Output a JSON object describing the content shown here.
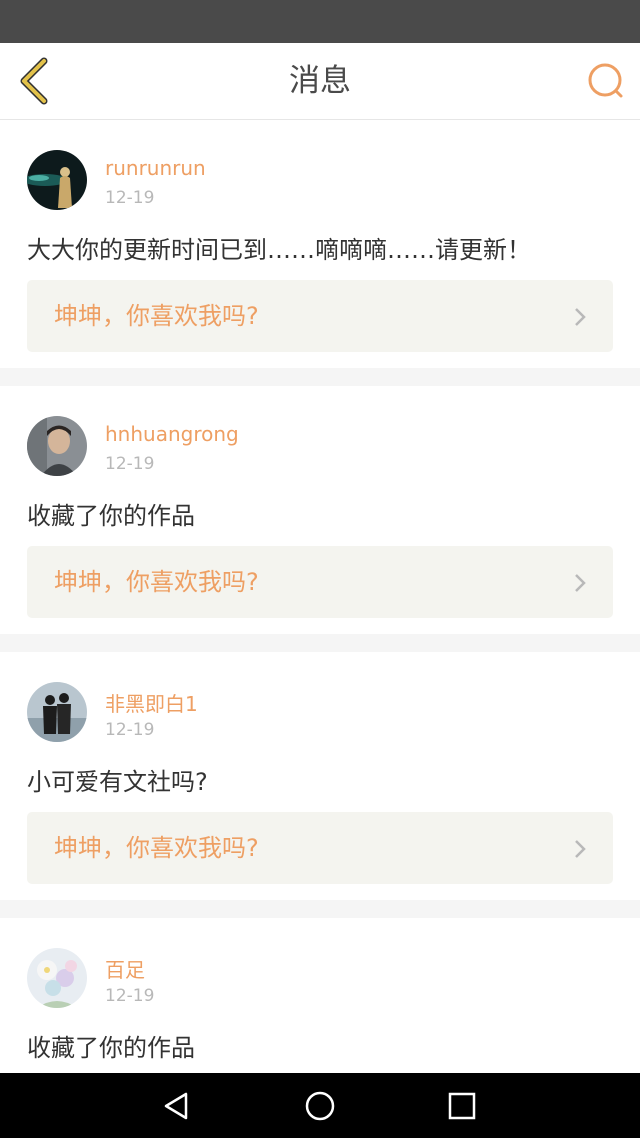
{
  "header": {
    "title": "消息",
    "back_icon": "chevron-left-icon",
    "search_icon": "search-icon"
  },
  "colors": {
    "accent": "#ee9f63",
    "back_icon": "#e3c24a",
    "text_primary": "#333333",
    "text_secondary": "#b8b8b8",
    "quote_bg": "#f4f4ef",
    "status_bar": "#4a4a4a",
    "nav_bar": "#000000"
  },
  "messages": [
    {
      "user": "runrunrun",
      "date": "12-19",
      "text": "大大你的更新时间已到……嘀嘀嘀……请更新！",
      "work_title": "坤坤，你喜欢我吗?"
    },
    {
      "user": "hnhuangrong",
      "date": "12-19",
      "text": "收藏了你的作品",
      "work_title": "坤坤，你喜欢我吗?"
    },
    {
      "user": "非黑即白1",
      "date": "12-19",
      "text": "小可爱有文社吗?",
      "work_title": "坤坤，你喜欢我吗?"
    },
    {
      "user": "百足",
      "date": "12-19",
      "text": "收藏了你的作品"
    }
  ],
  "nav": {
    "back_icon": "triangle-back-icon",
    "home_icon": "circle-home-icon",
    "recents_icon": "square-recents-icon"
  }
}
